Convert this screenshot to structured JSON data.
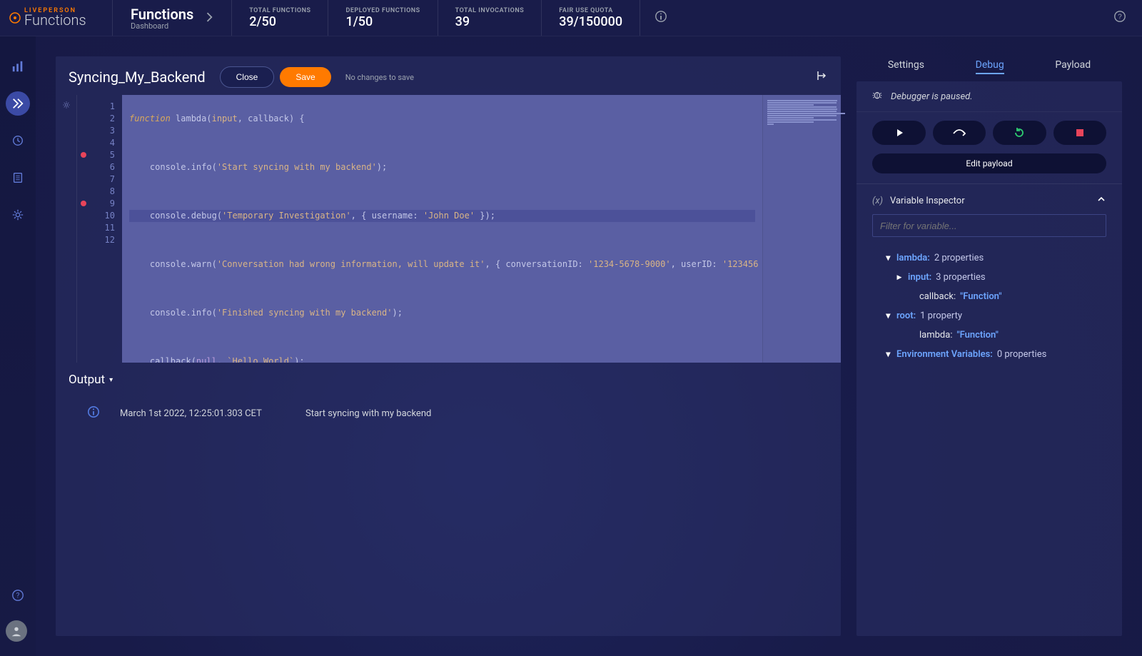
{
  "brand": {
    "top": "LIVEPERSON",
    "bottom": "Functions"
  },
  "breadcrumb": {
    "title": "Functions",
    "subtitle": "Dashboard"
  },
  "stats": {
    "total_functions": {
      "label": "TOTAL FUNCTIONS",
      "value": "2/50"
    },
    "deployed_functions": {
      "label": "DEPLOYED FUNCTIONS",
      "value": "1/50"
    },
    "total_invocations": {
      "label": "TOTAL INVOCATIONS",
      "value": "39"
    },
    "fair_use_quota": {
      "label": "FAIR USE QUOTA",
      "value": "39/150000"
    }
  },
  "editor": {
    "function_name": "Syncing_My_Backend",
    "close_label": "Close",
    "save_label": "Save",
    "save_msg": "No changes to save",
    "lines": [
      "1",
      "2",
      "3",
      "4",
      "5",
      "6",
      "7",
      "8",
      "9",
      "10",
      "11",
      "12"
    ],
    "breakpoints": [
      5,
      9
    ],
    "highlighted_line": 5,
    "code": {
      "l1_a": "function",
      "l1_b": " lambda(",
      "l1_c": "input",
      "l1_d": ", callback) {",
      "l3_a": "    console.info(",
      "l3_b": "'Start syncing with my backend'",
      "l3_c": ");",
      "l5_a": "    console.debug(",
      "l5_b": "'Temporary Investigation'",
      "l5_c": ", { username: ",
      "l5_d": "'John Doe'",
      "l5_e": " });",
      "l7_a": "    console.warn(",
      "l7_b": "'Conversation had wrong information, will update it'",
      "l7_c": ", { conversationID: ",
      "l7_d": "'1234-5678-9000'",
      "l7_e": ", userID: ",
      "l7_f": "'123456",
      "l9_a": "    console.info(",
      "l9_b": "'Finished syncing with my backend'",
      "l9_c": ");",
      "l11_a": "    callback(",
      "l11_b": "null",
      "l11_c": ", ",
      "l11_d": "`Hello World`",
      "l11_e": ");",
      "l12": "}"
    }
  },
  "output": {
    "title": "Output",
    "rows": [
      {
        "ts": "March 1st 2022, 12:25:01.303 CET",
        "msg": "Start syncing with my backend"
      }
    ]
  },
  "debug": {
    "tabs": {
      "settings": "Settings",
      "debug": "Debug",
      "payload": "Payload"
    },
    "status": "Debugger is paused.",
    "edit_payload": "Edit payload",
    "variable_inspector": {
      "title": "Variable Inspector",
      "filter_placeholder": "Filter for variable...",
      "tree": {
        "lambda": {
          "key": "lambda:",
          "val": "2 properties"
        },
        "input": {
          "key": "input:",
          "val": "3 properties"
        },
        "callback": {
          "key": "callback:",
          "val": "\"Function\""
        },
        "root": {
          "key": "root:",
          "val": "1 property"
        },
        "root_lambda": {
          "key": "lambda:",
          "val": "\"Function\""
        },
        "env": {
          "key": "Environment Variables:",
          "val": "0 properties"
        }
      }
    }
  }
}
